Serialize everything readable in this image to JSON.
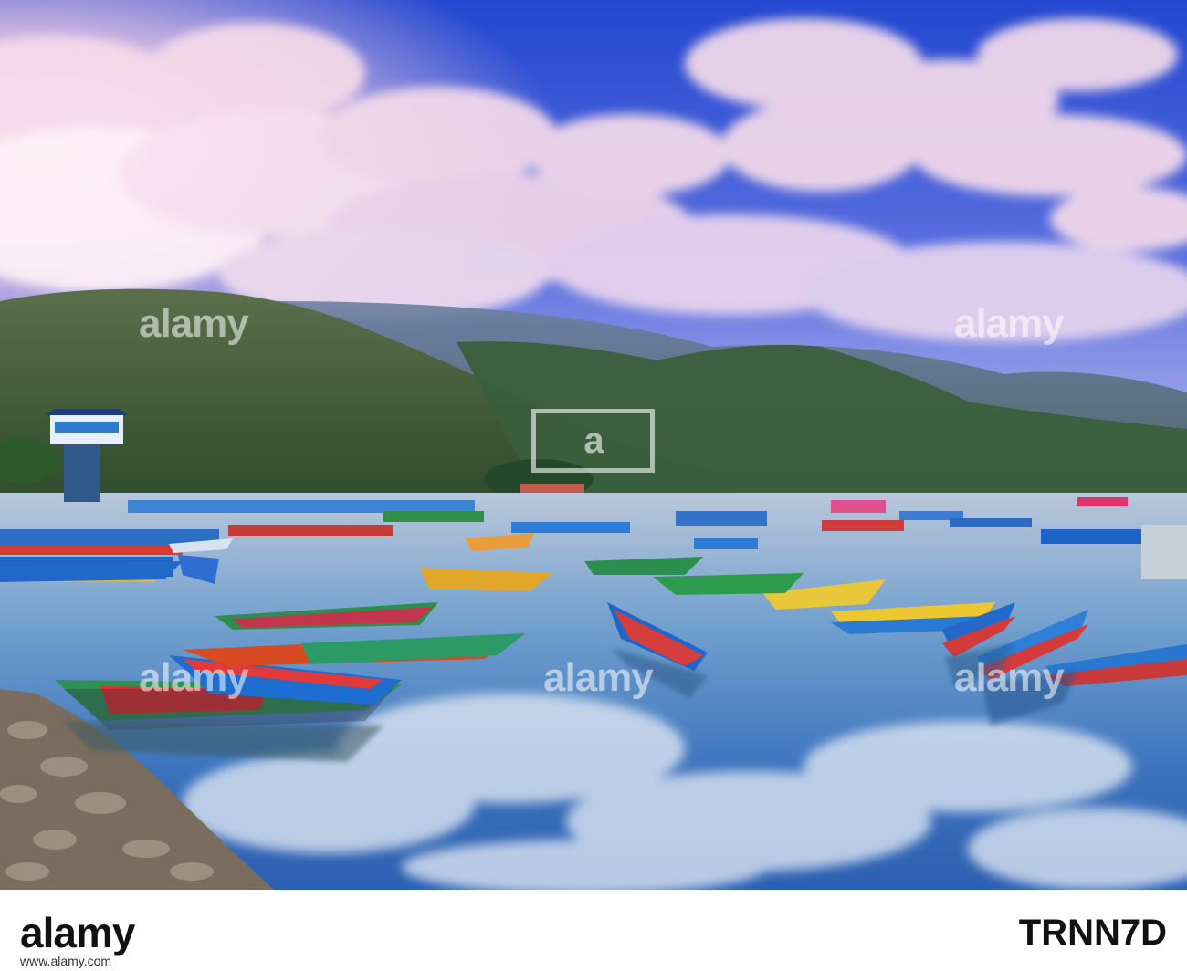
{
  "watermark": {
    "brand": "alamy",
    "letter_a": "a"
  },
  "footer": {
    "logo": "alamy",
    "image_id": "TRNN7D",
    "url": "www.alamy.com"
  },
  "colors": {
    "sky_top": "#2a4fd0",
    "sky_glow": "#f5c8e0",
    "mountain": "#3b5a2e",
    "water": "#6aa9cf"
  }
}
